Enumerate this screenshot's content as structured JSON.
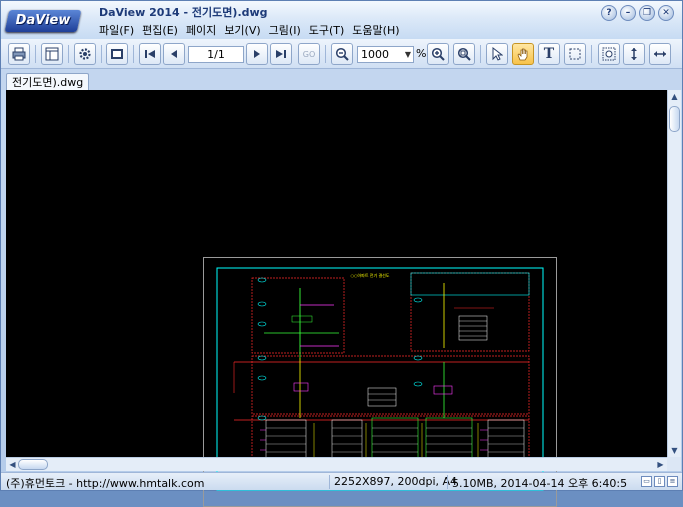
{
  "app": {
    "logo": "DaView",
    "title": "DaView 2014 - 전기도면).dwg"
  },
  "menu": [
    {
      "label": "파일(F)"
    },
    {
      "label": "편집(E)"
    },
    {
      "label": "페이지"
    },
    {
      "label": "보기(V)"
    },
    {
      "label": "그림(I)"
    },
    {
      "label": "도구(T)"
    },
    {
      "label": "도움말(H)"
    }
  ],
  "window_buttons": {
    "help": "?",
    "minimize": "–",
    "restore": "❐",
    "close": "✕"
  },
  "toolbar": {
    "page": "1/1",
    "goto_label": "GO",
    "zoom_value": "1000",
    "zoom_unit": "%",
    "text_tool": "T"
  },
  "tab": {
    "label": "전기도면).dwg"
  },
  "drawing": {
    "title_block_text": "○○아파트 전기 결선도",
    "top_label": "○○아파트 전기 결선도",
    "colors": {
      "frame": "#00ffff",
      "lines": "#ff2b2b",
      "panels": "#ffffff",
      "green": "#39ff3a",
      "yellow": "#ffff00",
      "magenta": "#ff3cff"
    }
  },
  "status": {
    "company": "(주)휴먼토크 - http://www.hmtalk.com",
    "resolution": "2252X897, 200dpi, A4",
    "fileinfo": "5.10MB, 2014-04-14 오후 6:40:5"
  },
  "colors": {
    "accent": "#1d3a78",
    "view_bg": "#000000",
    "chrome": "#c9ddf4"
  }
}
